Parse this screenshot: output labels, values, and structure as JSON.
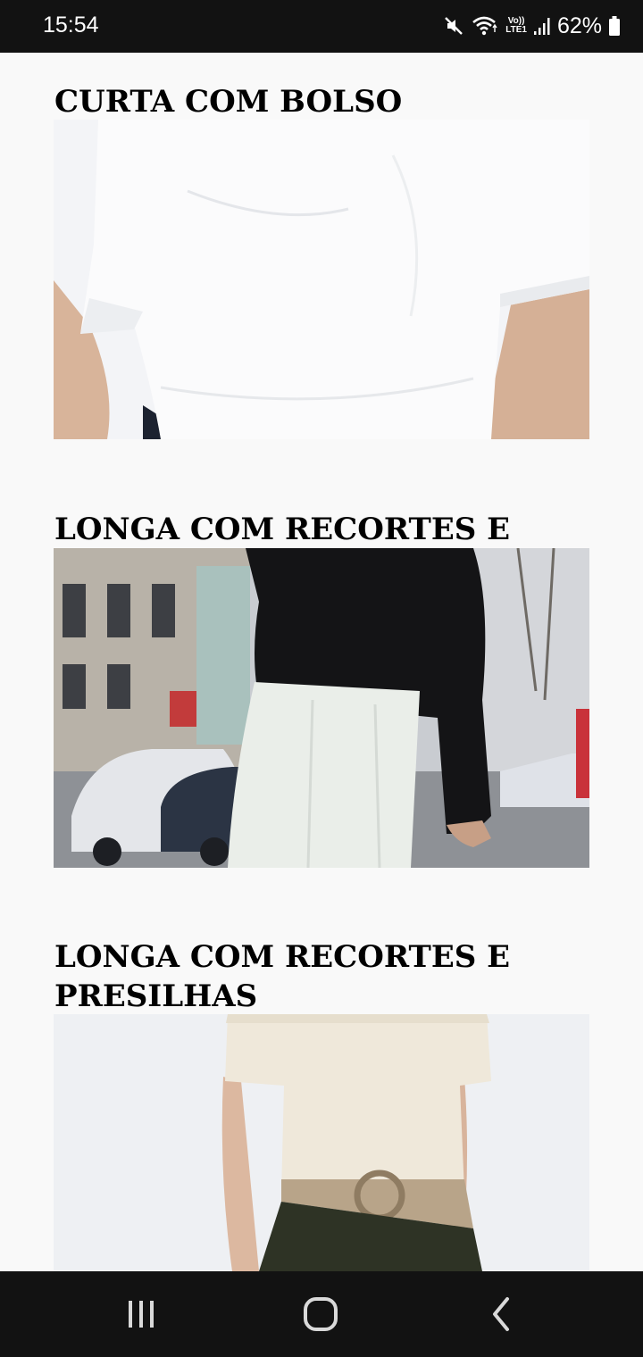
{
  "status_bar": {
    "time": "15:54",
    "network_label": "Vo))\nLTE1",
    "battery": "62%",
    "icons": [
      "mute-icon",
      "wifi-icon",
      "signal-icon",
      "battery-icon"
    ]
  },
  "products": [
    {
      "title": "CURTA COM BOLSO",
      "image": "white-tshirt-photo"
    },
    {
      "title": "LONGA COM RECORTES E CINTA",
      "image": "street-skirt-photo"
    },
    {
      "title": "LONGA COM RECORTES E PRESILHAS",
      "image": "belted-skirt-photo"
    }
  ],
  "nav_bar": {
    "icons": [
      "recent-apps-icon",
      "home-icon",
      "back-icon"
    ]
  },
  "colors": {
    "status_bg": "#121212",
    "page_bg": "#f9f9f9",
    "text": "#000000"
  }
}
